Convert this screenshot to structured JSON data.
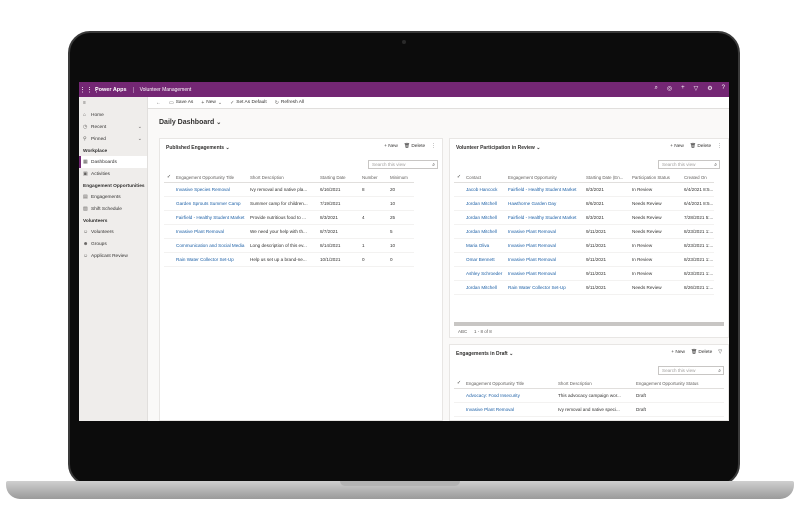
{
  "topbar": {
    "brand": "Power Apps",
    "app_name": "Volunteer Management",
    "icons": [
      "search-icon",
      "lightbulb-icon",
      "plus-icon",
      "filter-icon",
      "gear-icon",
      "help-icon"
    ]
  },
  "sidebar": {
    "top": [
      {
        "icon": "home-icon",
        "label": "Home"
      },
      {
        "icon": "clock-icon",
        "label": "Recent"
      },
      {
        "icon": "pin-icon",
        "label": "Pinned"
      }
    ],
    "groups": [
      {
        "label": "Workplace",
        "items": [
          {
            "icon": "dashboard-icon",
            "label": "Dashboards"
          },
          {
            "icon": "activity-icon",
            "label": "Activities"
          }
        ]
      },
      {
        "label": "Engagement Opportunities",
        "items": [
          {
            "icon": "calendar-icon",
            "label": "Engagements"
          },
          {
            "icon": "clipboard-icon",
            "label": "Shift Schedule"
          }
        ]
      },
      {
        "label": "Volunteers",
        "items": [
          {
            "icon": "person-icon",
            "label": "Volunteers"
          },
          {
            "icon": "group-icon",
            "label": "Groups"
          },
          {
            "icon": "person-review-icon",
            "label": "Applicant Review"
          }
        ]
      }
    ]
  },
  "commandbar": {
    "save_as": "Save As",
    "new": "New",
    "set_default": "Set As Default",
    "refresh_all": "Refresh All"
  },
  "dashboard": {
    "title": "Daily Dashboard"
  },
  "published": {
    "title": "Published Engagements",
    "new": "New",
    "delete": "Delete",
    "search_placeholder": "Search this view",
    "columns": [
      "Engagement Opportunity Title",
      "Short Description",
      "Starting Date",
      "Number",
      "Minimum"
    ],
    "rows": [
      [
        "Invasive Species Removal",
        "Ivy removal and native pla...",
        "6/16/2021",
        "8",
        "20"
      ],
      [
        "Garden Sprouts Summer Camp",
        "Summer camp for children...",
        "7/19/2021",
        "",
        "10"
      ],
      [
        "Fairfield - Healthy Student Market",
        "Provide nutritious food to ...",
        "8/3/2021",
        "4",
        "25"
      ],
      [
        "Invasive Plant Removal",
        "We need your help with th...",
        "8/7/2021",
        "",
        "5"
      ],
      [
        "Communication and Social Media",
        "Long description of this ev...",
        "8/14/2021",
        "1",
        "10"
      ],
      [
        "Rain Water Collector Set-Up",
        "Help us set up a brand-ne...",
        "10/1/2021",
        "0",
        "0"
      ]
    ]
  },
  "participation": {
    "title": "Volunteer Participation in Review",
    "new": "New",
    "delete": "Delete",
    "search_placeholder": "Search this view",
    "columns": [
      "Contact",
      "Engagement Opportunity",
      "Starting Date (En...",
      "Participation Status",
      "Created On"
    ],
    "rows": [
      [
        "Jacob Hancock",
        "Fairfield - Healthy Student Market",
        "8/3/2021",
        "In Review",
        "6/4/2021 8:5..."
      ],
      [
        "Jordan Mitchell",
        "Hawthorne Garden Day",
        "8/6/2021",
        "Needs Review",
        "6/4/2021 8:5..."
      ],
      [
        "Jordan Mitchell",
        "Fairfield - Healthy Student Market",
        "8/3/2021",
        "Needs Review",
        "7/28/2021 5:..."
      ],
      [
        "Jordan Mitchell",
        "Invasive Plant Removal",
        "9/11/2021",
        "Needs Review",
        "8/23/2021 1:..."
      ],
      [
        "Maria Oliva",
        "Invasive Plant Removal",
        "9/11/2021",
        "In Review",
        "8/23/2021 1:..."
      ],
      [
        "Omar Bennett",
        "Invasive Plant Removal",
        "9/11/2021",
        "In Review",
        "8/23/2021 1:..."
      ],
      [
        "Ashley Schroeder",
        "Invasive Plant Removal",
        "9/11/2021",
        "In Review",
        "8/23/2021 1:..."
      ],
      [
        "Jordan Mitchell",
        "Rain Water Collector Set-Up",
        "9/11/2021",
        "Needs Review",
        "8/26/2021 1:..."
      ]
    ],
    "footer_abc": "ABC",
    "footer_count": "1 - 8 of 8"
  },
  "drafts": {
    "title": "Engagements in Draft",
    "new": "New",
    "delete": "Delete",
    "search_placeholder": "Search this view",
    "columns": [
      "Engagement Opportunity Title",
      "Short Description",
      "Engagement Opportunity Status"
    ],
    "rows": [
      [
        "Advocacy: Food Insecurity",
        "This advocacy campaign wor...",
        "Draft"
      ],
      [
        "Invasive Plant Removal",
        "Ivy removal and native speci...",
        "Draft"
      ]
    ]
  },
  "colors": {
    "brand": "#742774",
    "link": "#1b5fa6"
  }
}
